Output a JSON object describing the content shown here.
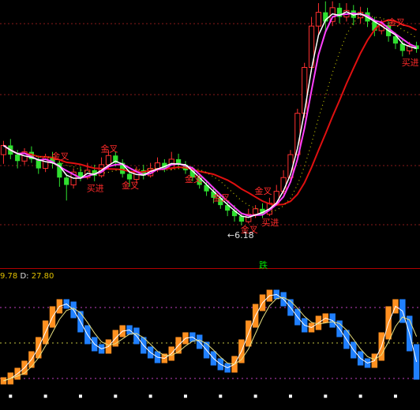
{
  "chart_data": [
    {
      "type": "candlestick",
      "panel": "price",
      "low_marker": "6.18",
      "signal_labels": [
        "金叉",
        "买进"
      ],
      "bottom_label": "跌",
      "colors": {
        "up": "#ff3030",
        "down": "#30e030",
        "ma_short": "#ffffff",
        "ma_mid": "#ff40ff",
        "ma_long": "#e01010",
        "dotted": "#c0c000"
      },
      "ylim": [
        5.8,
        8.6
      ],
      "candles": [
        [
          6.95,
          7.05,
          7.1,
          6.85
        ],
        [
          7.05,
          6.95,
          7.12,
          6.9
        ],
        [
          6.95,
          6.88,
          7.0,
          6.8
        ],
        [
          6.88,
          6.98,
          7.02,
          6.84
        ],
        [
          6.98,
          6.9,
          7.04,
          6.86
        ],
        [
          6.9,
          6.8,
          6.94,
          6.74
        ],
        [
          6.8,
          6.92,
          6.96,
          6.76
        ],
        [
          6.92,
          6.86,
          6.98,
          6.8
        ],
        [
          6.86,
          6.7,
          6.88,
          6.6
        ],
        [
          6.7,
          6.62,
          6.74,
          6.45
        ],
        [
          6.62,
          6.76,
          6.8,
          6.58
        ],
        [
          6.76,
          6.7,
          6.82,
          6.66
        ],
        [
          6.7,
          6.78,
          6.86,
          6.68
        ],
        [
          6.78,
          6.72,
          6.84,
          6.66
        ],
        [
          6.72,
          6.84,
          6.92,
          6.7
        ],
        [
          6.84,
          6.94,
          7.0,
          6.8
        ],
        [
          6.94,
          6.86,
          6.98,
          6.82
        ],
        [
          6.86,
          6.74,
          6.9,
          6.7
        ],
        [
          6.74,
          6.68,
          6.78,
          6.6
        ],
        [
          6.68,
          6.78,
          6.82,
          6.64
        ],
        [
          6.78,
          6.72,
          6.84,
          6.68
        ],
        [
          6.72,
          6.8,
          6.86,
          6.7
        ],
        [
          6.8,
          6.86,
          6.92,
          6.76
        ],
        [
          6.86,
          6.8,
          6.9,
          6.76
        ],
        [
          6.8,
          6.9,
          6.98,
          6.78
        ],
        [
          6.9,
          6.84,
          6.96,
          6.8
        ],
        [
          6.84,
          6.78,
          6.88,
          6.74
        ],
        [
          6.78,
          6.7,
          6.82,
          6.66
        ],
        [
          6.7,
          6.62,
          6.74,
          6.58
        ],
        [
          6.62,
          6.55,
          6.66,
          6.5
        ],
        [
          6.55,
          6.48,
          6.6,
          6.42
        ],
        [
          6.48,
          6.4,
          6.52,
          6.36
        ],
        [
          6.4,
          6.34,
          6.44,
          6.28
        ],
        [
          6.34,
          6.28,
          6.4,
          6.22
        ],
        [
          6.28,
          6.22,
          6.32,
          6.18
        ],
        [
          6.22,
          6.3,
          6.36,
          6.2
        ],
        [
          6.3,
          6.36,
          6.4,
          6.26
        ],
        [
          6.36,
          6.3,
          6.42,
          6.26
        ],
        [
          6.3,
          6.42,
          6.48,
          6.28
        ],
        [
          6.42,
          6.55,
          6.62,
          6.4
        ],
        [
          6.55,
          6.7,
          6.78,
          6.52
        ],
        [
          6.7,
          6.95,
          7.0,
          6.66
        ],
        [
          6.95,
          7.4,
          7.45,
          6.92
        ],
        [
          7.4,
          7.9,
          7.95,
          7.35
        ],
        [
          7.9,
          8.35,
          8.45,
          7.85
        ],
        [
          8.35,
          8.5,
          8.6,
          8.25
        ],
        [
          8.5,
          8.4,
          8.62,
          8.3
        ],
        [
          8.4,
          8.55,
          8.62,
          8.35
        ],
        [
          8.55,
          8.45,
          8.6,
          8.38
        ],
        [
          8.45,
          8.52,
          8.6,
          8.4
        ],
        [
          8.52,
          8.44,
          8.58,
          8.36
        ],
        [
          8.44,
          8.5,
          8.56,
          8.38
        ],
        [
          8.5,
          8.4,
          8.55,
          8.34
        ],
        [
          8.4,
          8.3,
          8.45,
          8.24
        ],
        [
          8.3,
          8.36,
          8.42,
          8.26
        ],
        [
          8.36,
          8.24,
          8.4,
          8.18
        ],
        [
          8.24,
          8.16,
          8.28,
          8.1
        ],
        [
          8.16,
          8.08,
          8.2,
          8.02
        ],
        [
          8.08,
          8.14,
          8.18,
          8.04
        ],
        [
          8.14,
          8.1,
          8.18,
          8.06
        ]
      ]
    },
    {
      "type": "bar",
      "panel": "oscillator",
      "readout": {
        "v1": "9.78",
        "d_label": "D:",
        "d_value": "27.80"
      },
      "colors": {
        "up": "#ff9020",
        "down": "#2080ff",
        "k": "#ffffff",
        "d": "#e8e080"
      },
      "ylim": [
        0,
        100
      ],
      "levels": [
        80,
        50,
        20
      ],
      "values": [
        18,
        22,
        26,
        32,
        40,
        52,
        66,
        78,
        84,
        82,
        74,
        62,
        52,
        46,
        44,
        50,
        58,
        62,
        60,
        52,
        44,
        40,
        36,
        38,
        44,
        52,
        56,
        54,
        48,
        40,
        34,
        30,
        28,
        36,
        50,
        66,
        80,
        88,
        92,
        90,
        84,
        76,
        68,
        62,
        64,
        70,
        72,
        66,
        58,
        48,
        40,
        34,
        32,
        38,
        56,
        78,
        84,
        70,
        46,
        22
      ]
    }
  ]
}
